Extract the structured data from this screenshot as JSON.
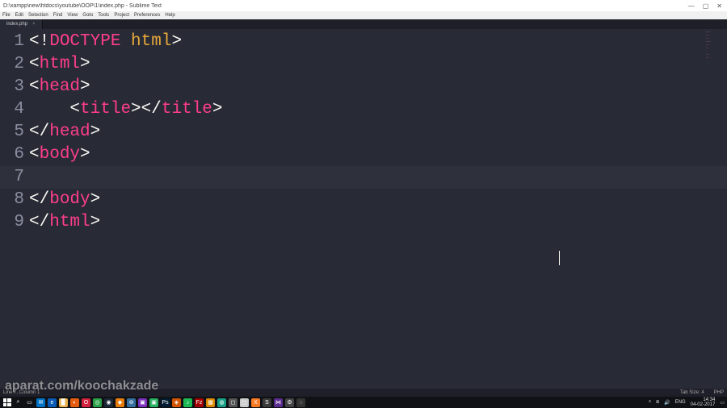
{
  "titlebar": {
    "path": "D:\\xampp\\new\\htdocs\\youtube\\OOP\\1\\index.php - Sublime Text"
  },
  "window_controls": {
    "min": "—",
    "max": "▢",
    "close": "✕"
  },
  "menu": {
    "file": "File",
    "edit": "Edit",
    "selection": "Selection",
    "find": "Find",
    "view": "View",
    "goto": "Goto",
    "tools": "Tools",
    "project": "Project",
    "preferences": "Preferences",
    "help": "Help"
  },
  "tab": {
    "name": "index.php",
    "close": "×"
  },
  "gutter": [
    "1",
    "2",
    "3",
    "4",
    "5",
    "6",
    "7",
    "8",
    "9"
  ],
  "code": {
    "l1": {
      "a": "<!",
      "b": "DOCTYPE",
      "c": " html",
      "d": ">"
    },
    "l2": {
      "a": "<",
      "b": "html",
      "c": ">"
    },
    "l3": {
      "a": "<",
      "b": "head",
      "c": ">"
    },
    "l4": {
      "indent": "    ",
      "a": "<",
      "b": "title",
      "c": "></",
      "d": "title",
      "e": ">"
    },
    "l5": {
      "a": "</",
      "b": "head",
      "c": ">"
    },
    "l6": {
      "a": "<",
      "b": "body",
      "c": ">"
    },
    "l7": "",
    "l8": {
      "a": "</",
      "b": "body",
      "c": ">"
    },
    "l9": {
      "a": "</",
      "b": "html",
      "c": ">"
    }
  },
  "status": {
    "left": "Line 7, Column 1",
    "tabsize": "Tab Size: 4",
    "syntax": "PHP"
  },
  "watermark": "aparat.com/koochakzade",
  "tray": {
    "lang": "ENG",
    "time": "14:34",
    "date": "04-02-2017"
  },
  "taskbar_icons": [
    {
      "name": "start",
      "bg": "#101114",
      "glyph": ""
    },
    {
      "name": "search",
      "bg": "#101114",
      "glyph": "⌕"
    },
    {
      "name": "taskview",
      "bg": "#101114",
      "glyph": "▭"
    },
    {
      "name": "mail",
      "bg": "#0072c6",
      "glyph": "✉"
    },
    {
      "name": "edge",
      "bg": "#0a5bb5",
      "glyph": "e"
    },
    {
      "name": "explorer",
      "bg": "#e6b04a",
      "glyph": "▉"
    },
    {
      "name": "firefox",
      "bg": "#e55b10",
      "glyph": "◐"
    },
    {
      "name": "opera",
      "bg": "#d4213d",
      "glyph": "O"
    },
    {
      "name": "chrome",
      "bg": "#2aa147",
      "glyph": "◎"
    },
    {
      "name": "steam",
      "bg": "#1b2838",
      "glyph": "◉"
    },
    {
      "name": "blender",
      "bg": "#e87d0d",
      "glyph": "◆"
    },
    {
      "name": "python",
      "bg": "#356f9f",
      "glyph": "⊚"
    },
    {
      "name": "app-purple",
      "bg": "#7b2fbf",
      "glyph": "▣"
    },
    {
      "name": "app-green",
      "bg": "#27ae60",
      "glyph": "▣"
    },
    {
      "name": "photoshop",
      "bg": "#001d34",
      "glyph": "Ps"
    },
    {
      "name": "app-orange",
      "bg": "#d35400",
      "glyph": "◈"
    },
    {
      "name": "spotify",
      "bg": "#1db954",
      "glyph": "♪"
    },
    {
      "name": "filezilla",
      "bg": "#a50000",
      "glyph": "Fz"
    },
    {
      "name": "mysql",
      "bg": "#dd8a00",
      "glyph": "▦"
    },
    {
      "name": "app-teal",
      "bg": "#16a085",
      "glyph": "◍"
    },
    {
      "name": "app-grey",
      "bg": "#555",
      "glyph": "◻"
    },
    {
      "name": "app-white",
      "bg": "#ccc",
      "glyph": "◻"
    },
    {
      "name": "xampp",
      "bg": "#fb7a24",
      "glyph": "X"
    },
    {
      "name": "sublime",
      "bg": "#3b3b3b",
      "glyph": "S"
    },
    {
      "name": "vs",
      "bg": "#5c2d91",
      "glyph": "⋈"
    },
    {
      "name": "app-gear",
      "bg": "#444",
      "glyph": "⚙"
    },
    {
      "name": "app-last",
      "bg": "#333",
      "glyph": "◌"
    }
  ]
}
